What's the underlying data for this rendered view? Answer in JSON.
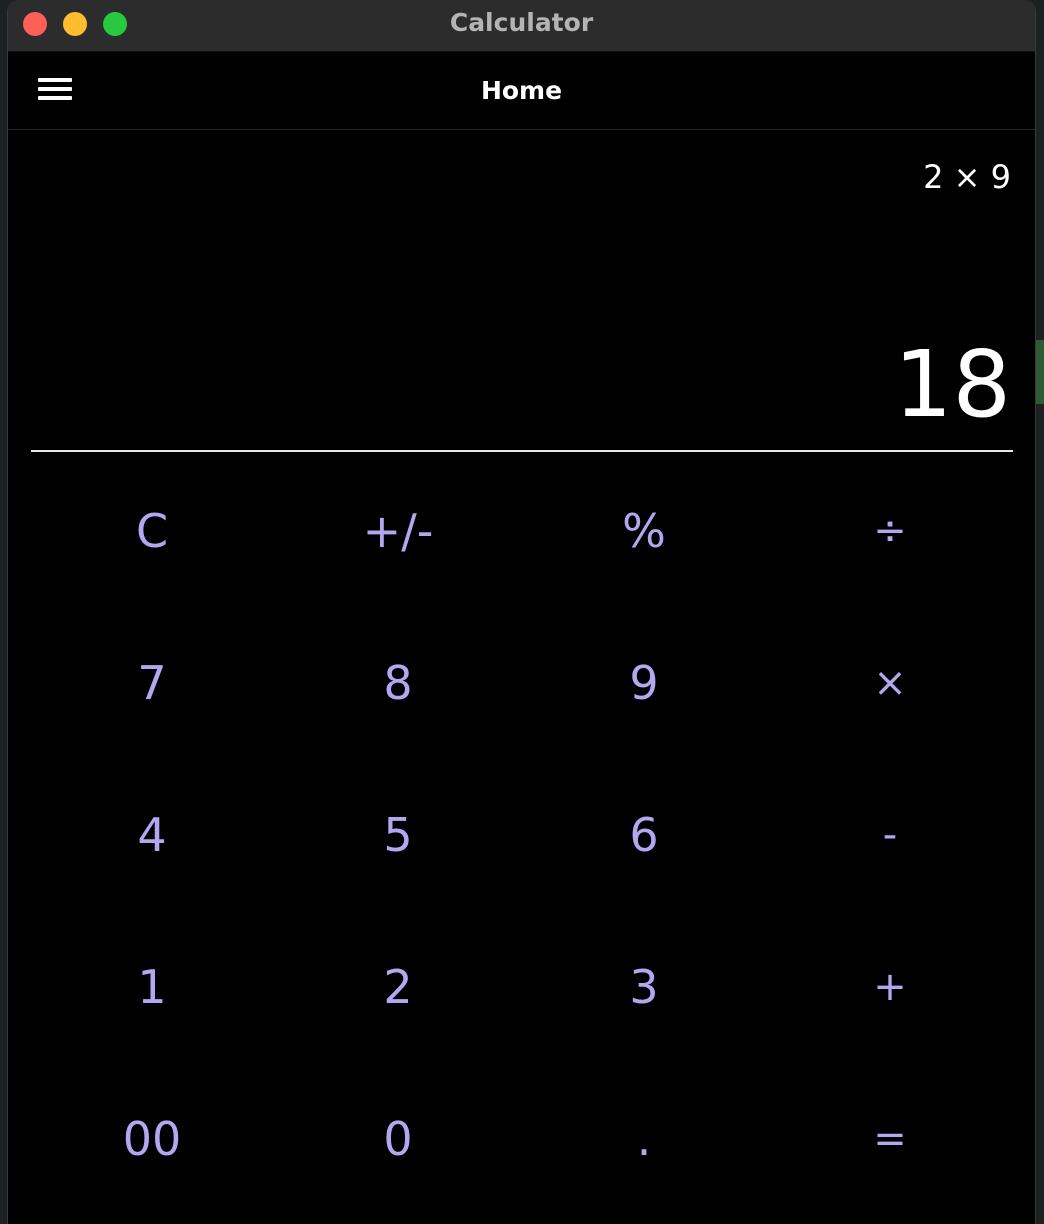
{
  "window": {
    "title": "Calculator"
  },
  "appbar": {
    "title": "Home",
    "menu_icon": "hamburger-menu-icon"
  },
  "display": {
    "expression": "2 × 9",
    "result": "18"
  },
  "keypad": {
    "rows": [
      [
        "C",
        "+/-",
        "%",
        "÷"
      ],
      [
        "7",
        "8",
        "9",
        "×"
      ],
      [
        "4",
        "5",
        "6",
        "-"
      ],
      [
        "1",
        "2",
        "3",
        "+"
      ],
      [
        "00",
        "0",
        ".",
        "="
      ]
    ]
  },
  "colors": {
    "key_text": "#b5a6f0",
    "background": "#000000",
    "titlebar": "#2c2c2c",
    "display_text": "#ffffff"
  }
}
